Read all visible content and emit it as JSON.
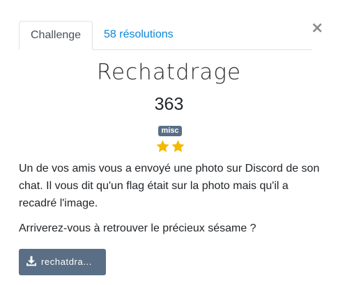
{
  "tabs": [
    {
      "label": "Challenge",
      "active": true
    },
    {
      "label": "58 résolutions",
      "active": false
    }
  ],
  "close": {
    "glyph": "×",
    "icon": "close-icon"
  },
  "challenge": {
    "name": "Rechatdrage",
    "points": "363",
    "category": "misc",
    "difficulty_stars": 2,
    "star_color": "#f5b800",
    "description": [
      "Un de vos amis vous a envoyé une photo sur Discord de son chat. Il vous dit qu'un flag était sur la photo mais qu'il a recadré l'image.",
      "Arriverez-vous à retrouver le précieux sésame ?"
    ]
  },
  "download": {
    "label": "rechatdra...",
    "icon": "download-icon"
  },
  "colors": {
    "link": "#0d86d6",
    "badge": "#5a6f86",
    "button": "#5a6f86"
  }
}
